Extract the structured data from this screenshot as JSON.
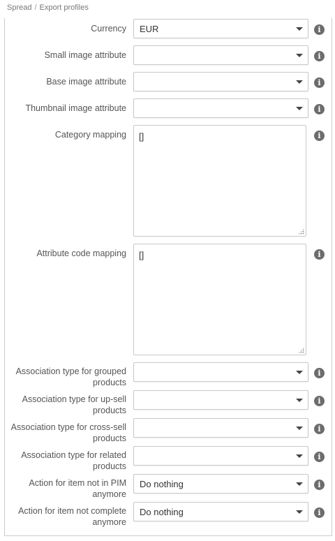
{
  "breadcrumb": {
    "part1": "Spread",
    "separator": "/",
    "part2": "Export profiles"
  },
  "fields": {
    "currency": {
      "label": "Currency",
      "value": "EUR"
    },
    "small_image": {
      "label": "Small image attribute",
      "value": ""
    },
    "base_image": {
      "label": "Base image attribute",
      "value": ""
    },
    "thumbnail_image": {
      "label": "Thumbnail image attribute",
      "value": ""
    },
    "category_mapping": {
      "label": "Category mapping",
      "value": "[]"
    },
    "attribute_code_mapping": {
      "label": "Attribute code mapping",
      "value": "[]"
    },
    "assoc_grouped": {
      "label": "Association type for grouped products",
      "value": ""
    },
    "assoc_upsell": {
      "label": "Association type for up-sell products",
      "value": ""
    },
    "assoc_crosssell": {
      "label": "Association type for cross-sell products",
      "value": ""
    },
    "assoc_related": {
      "label": "Association type for related products",
      "value": ""
    },
    "action_not_in_pim": {
      "label": "Action for item not in PIM anymore",
      "value": "Do nothing"
    },
    "action_not_complete": {
      "label": "Action for item not complete anymore",
      "value": "Do nothing"
    }
  },
  "icons": {
    "info": "info-icon",
    "dropdown": "chevron-down-icon"
  }
}
